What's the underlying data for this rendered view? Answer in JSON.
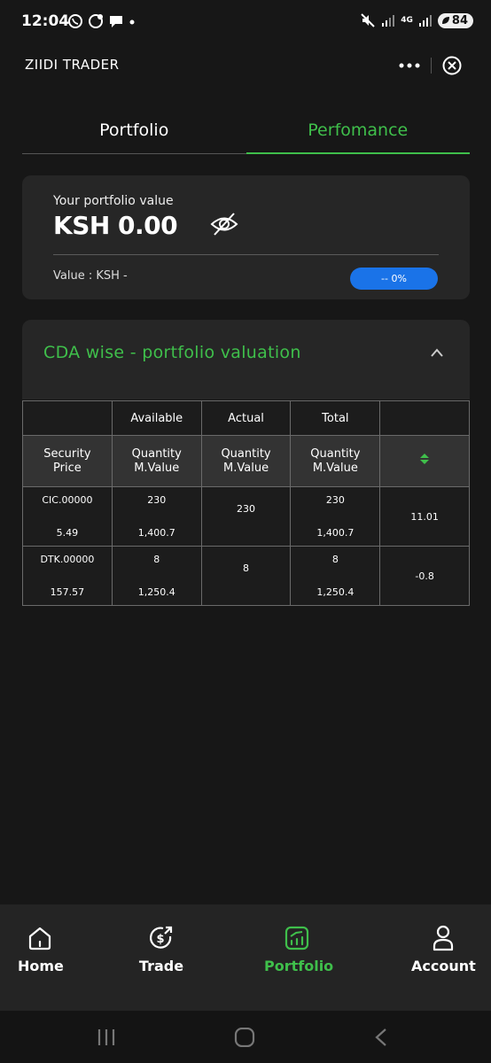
{
  "status_bar": {
    "time": "12:04",
    "network": "4G",
    "battery": "84"
  },
  "header": {
    "title": "ZIIDI TRADER"
  },
  "tabs": [
    {
      "label": "Portfolio",
      "active": false
    },
    {
      "label": "Perfomance",
      "active": true
    }
  ],
  "portfolio": {
    "label": "Your portfolio value",
    "amount": "KSH 0.00",
    "sub_value": "Value : KSH -",
    "change": "-- 0%"
  },
  "cda": {
    "title": "CDA wise - portfolio valuation"
  },
  "table": {
    "group_headers": [
      "",
      "Available",
      "Actual",
      "Total",
      ""
    ],
    "sub_headers": [
      {
        "line1": "Security",
        "line2": "Price"
      },
      {
        "line1": "Quantity",
        "line2": "M.Value"
      },
      {
        "line1": "Quantity",
        "line2": "M.Value"
      },
      {
        "line1": "Quantity",
        "line2": "M.Value"
      }
    ],
    "rows": [
      {
        "security": "CIC.00000",
        "price": "5.49",
        "avail_qty": "230",
        "avail_value": "1,400.7",
        "actual_qty": "230",
        "total_qty": "230",
        "total_value": "1,400.7",
        "change": "11.01",
        "trend": "up"
      },
      {
        "security": "DTK.00000",
        "price": "157.57",
        "avail_qty": "8",
        "avail_value": "1,250.4",
        "actual_qty": "8",
        "total_qty": "8",
        "total_value": "1,250.4",
        "change": "-0.8",
        "trend": "down"
      }
    ]
  },
  "bottom_nav": [
    {
      "label": "Home",
      "icon": "home-icon",
      "active": false
    },
    {
      "label": "Trade",
      "icon": "dollar-exchange-icon",
      "active": false
    },
    {
      "label": "Portfolio",
      "icon": "chart-growth-icon",
      "active": true
    },
    {
      "label": "Account",
      "icon": "user-icon",
      "active": false
    }
  ],
  "colors": {
    "accent_green": "#3fbf4b",
    "negative_red": "#e24a4a",
    "pill_blue": "#1a73e8",
    "background": "#171717"
  }
}
